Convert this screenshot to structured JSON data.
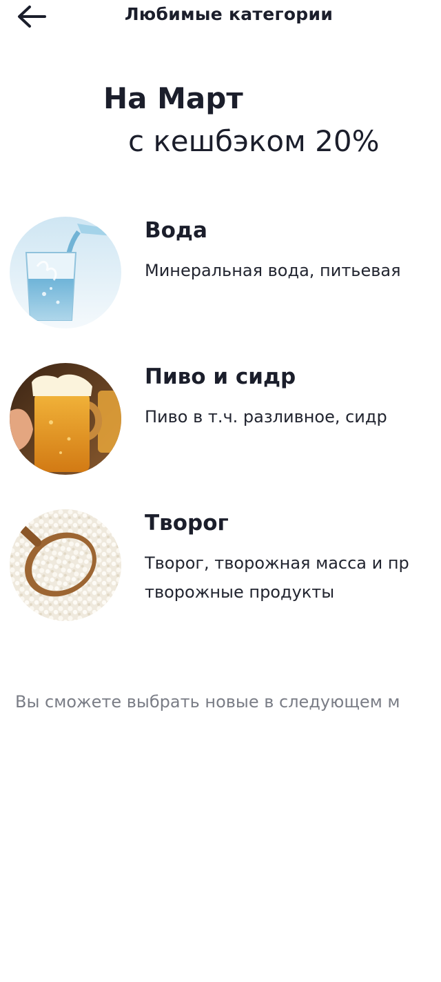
{
  "topbar": {
    "back_icon": "arrow-left-icon",
    "title": "Любимые категории"
  },
  "hero": {
    "line1": "На Март",
    "line2": "с кешбэком 20%"
  },
  "categories": [
    {
      "title": "Вода",
      "desc_line1": "Минеральная вода, питьевая",
      "desc_line2": "",
      "image": "water-glass-image"
    },
    {
      "title": "Пиво и сидр",
      "desc_line1": "Пиво в т.ч. разливное, сидр",
      "desc_line2": "",
      "image": "beer-mug-image"
    },
    {
      "title": "Творог",
      "desc_line1": "Творог, творожная масса и пр",
      "desc_line2": "творожные продукты",
      "image": "cottage-cheese-image"
    }
  ],
  "footer": {
    "note": "Вы сможете выбрать новые в следующем м"
  }
}
